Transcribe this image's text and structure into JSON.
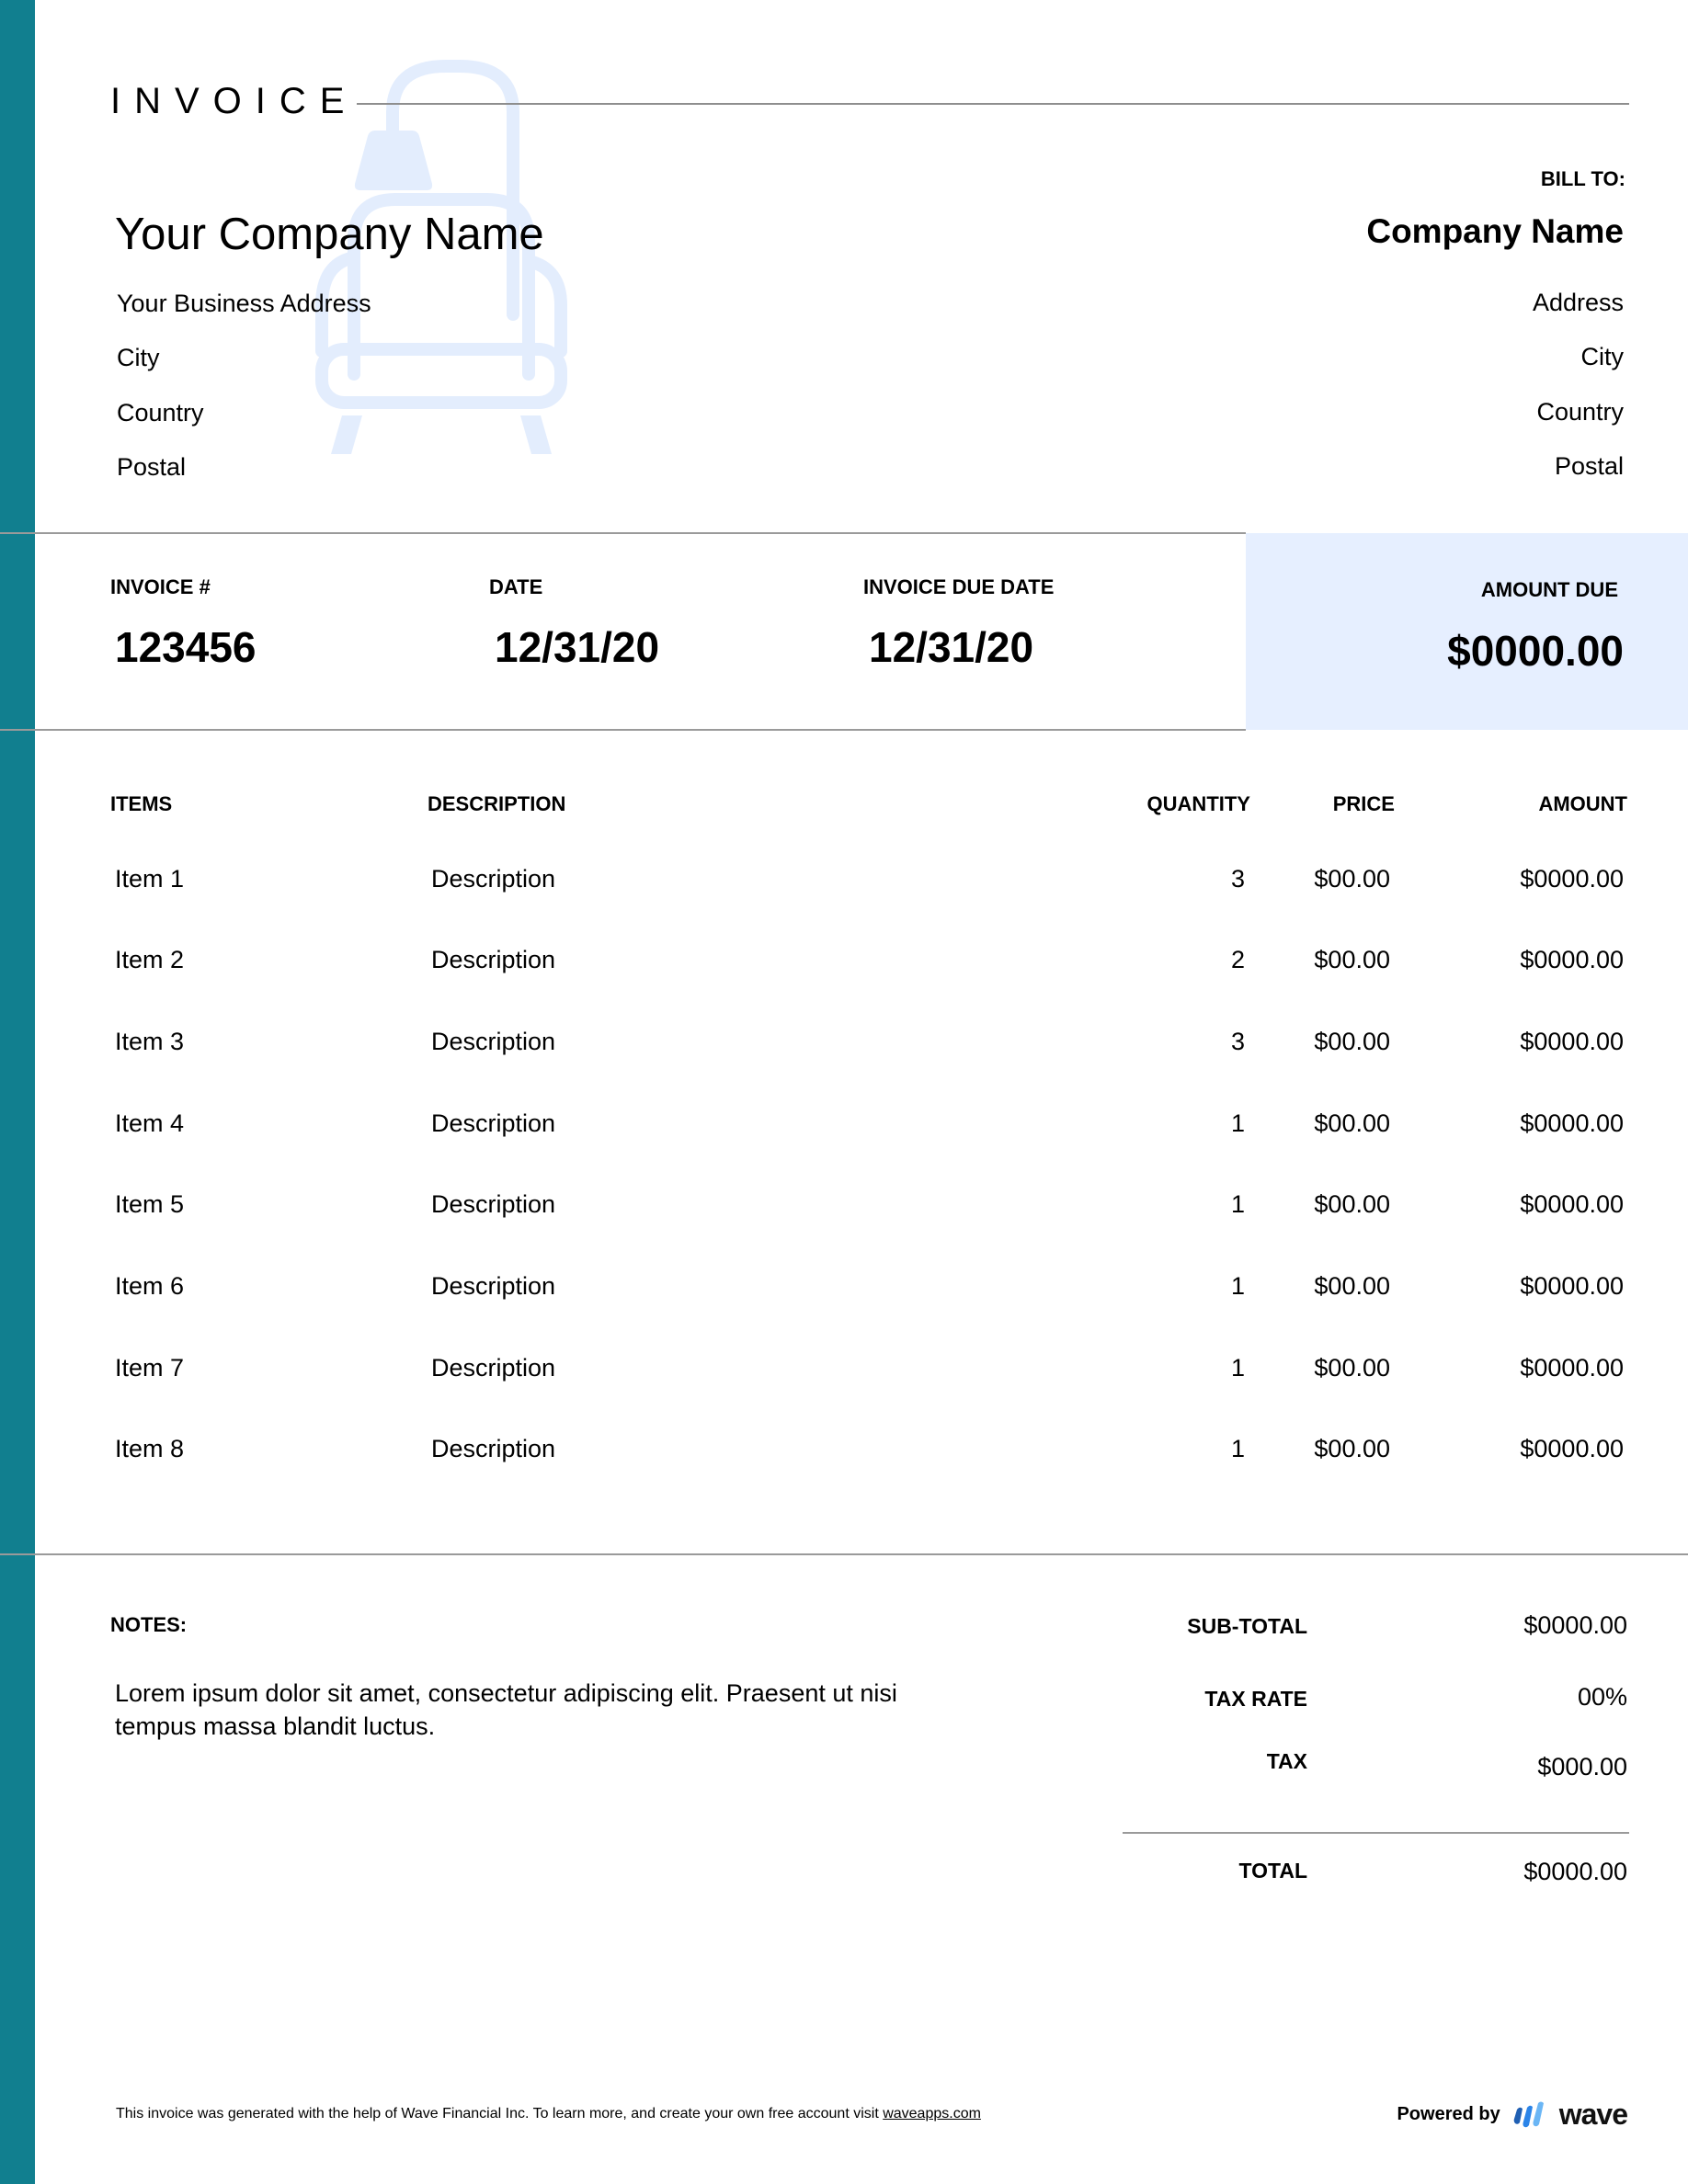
{
  "colors": {
    "accent_bar": "#117f8f",
    "amount_due_bg": "#e6efff",
    "watermark": "#e3edfd",
    "rule": "#9a9a9a"
  },
  "header": {
    "title": "INVOICE",
    "watermark_icon": "lamp-armchair-icon"
  },
  "sender": {
    "company_name": "Your Company Name",
    "address": "Your Business Address",
    "city": "City",
    "country": "Country",
    "postal": "Postal"
  },
  "bill_to": {
    "label": "BILL TO:",
    "company_name": "Company Name",
    "address": "Address",
    "city": "City",
    "country": "Country",
    "postal": "Postal"
  },
  "meta": {
    "invoice_number_label": "INVOICE #",
    "invoice_number": "123456",
    "date_label": "DATE",
    "date": "12/31/20",
    "due_date_label": "INVOICE DUE DATE",
    "due_date": "12/31/20",
    "amount_due_label": "AMOUNT DUE",
    "amount_due": "$0000.00"
  },
  "table": {
    "headers": {
      "items": "ITEMS",
      "description": "DESCRIPTION",
      "quantity": "QUANTITY",
      "price": "PRICE",
      "amount": "AMOUNT"
    },
    "rows": [
      {
        "item": "Item 1",
        "description": "Description",
        "quantity": "3",
        "price": "$00.00",
        "amount": "$0000.00"
      },
      {
        "item": "Item 2",
        "description": "Description",
        "quantity": "2",
        "price": "$00.00",
        "amount": "$0000.00"
      },
      {
        "item": "Item 3",
        "description": "Description",
        "quantity": "3",
        "price": "$00.00",
        "amount": "$0000.00"
      },
      {
        "item": "Item 4",
        "description": "Description",
        "quantity": "1",
        "price": "$00.00",
        "amount": "$0000.00"
      },
      {
        "item": "Item 5",
        "description": "Description",
        "quantity": "1",
        "price": "$00.00",
        "amount": "$0000.00"
      },
      {
        "item": "Item 6",
        "description": "Description",
        "quantity": "1",
        "price": "$00.00",
        "amount": "$0000.00"
      },
      {
        "item": "Item 7",
        "description": "Description",
        "quantity": "1",
        "price": "$00.00",
        "amount": "$0000.00"
      },
      {
        "item": "Item 8",
        "description": "Description",
        "quantity": "1",
        "price": "$00.00",
        "amount": "$0000.00"
      }
    ]
  },
  "notes": {
    "label": "NOTES:",
    "text": "Lorem ipsum dolor sit amet, consectetur adipiscing elit. Praesent ut nisi tempus massa blandit luctus."
  },
  "totals": {
    "subtotal_label": "SUB-TOTAL",
    "subtotal": "$0000.00",
    "tax_rate_label": "TAX RATE",
    "tax_rate": "00%",
    "tax_label": "TAX",
    "tax": "$000.00",
    "total_label": "TOTAL",
    "total": "$0000.00"
  },
  "footer": {
    "text": "This invoice was generated with the help of Wave Financial Inc. To learn more, and create your own free account visit ",
    "link_text": "waveapps.com",
    "powered_by": "Powered by",
    "brand": "wave",
    "brand_icon": "wave-logo-icon"
  }
}
